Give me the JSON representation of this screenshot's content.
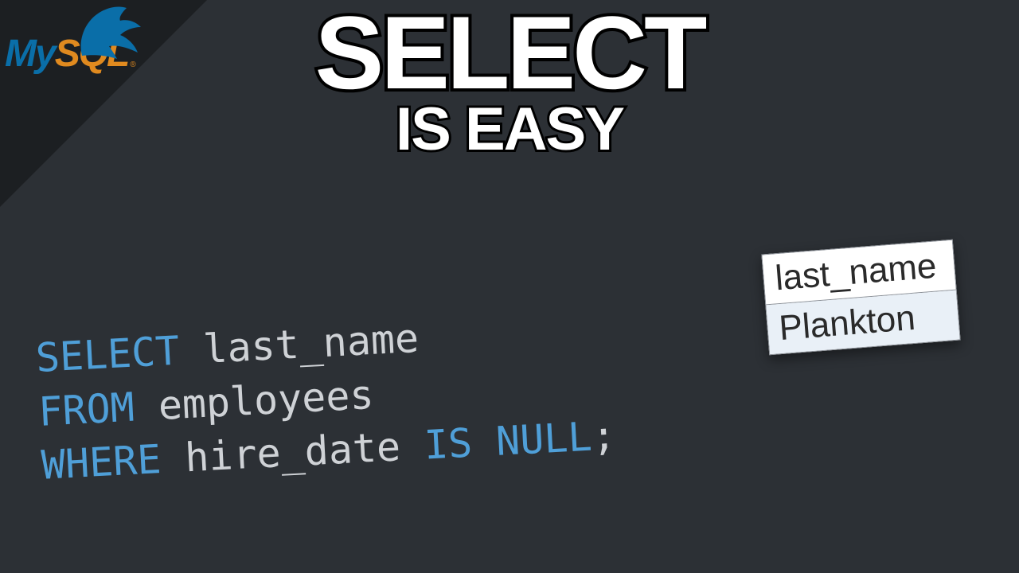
{
  "logo": {
    "part1": "My",
    "part2": "SQL",
    "trademark": "®"
  },
  "title": {
    "main": "SELECT",
    "sub": "IS EASY"
  },
  "code": {
    "kw_select": "SELECT",
    "col": " last_name",
    "kw_from": "FROM",
    "table": " employees",
    "kw_where": "WHERE",
    "cond_col": " hire_date ",
    "kw_isnull": "IS NULL",
    "semi": ";"
  },
  "result": {
    "header": "last_name",
    "rows": [
      "Plankton"
    ]
  }
}
